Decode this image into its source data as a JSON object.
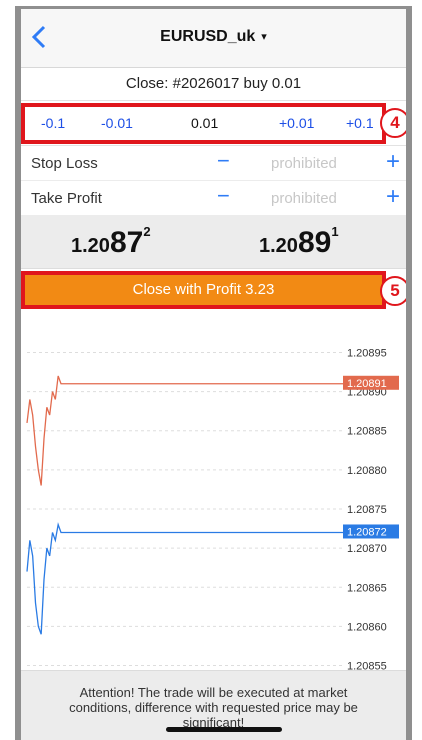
{
  "header": {
    "title": "EURUSD_uk",
    "caret": "▾",
    "back_icon": "chevron-left-icon"
  },
  "close_line": "Close: #2026017 buy 0.01",
  "volume": {
    "dec_large": "-0.1",
    "dec_small": "-0.01",
    "value": "0.01",
    "inc_small": "+0.01",
    "inc_large": "+0.1"
  },
  "callouts": {
    "first": "4",
    "second": "5"
  },
  "stop_loss": {
    "label": "Stop Loss",
    "minus": "−",
    "value": "prohibited",
    "plus": "+"
  },
  "take_profit": {
    "label": "Take Profit",
    "minus": "−",
    "value": "prohibited",
    "plus": "+"
  },
  "prices": {
    "bid": {
      "pre": "1.20",
      "big": "87",
      "sup": "2"
    },
    "ask": {
      "pre": "1.20",
      "big": "89",
      "sup": "1"
    }
  },
  "close_button": "Close with Profit 3.23",
  "chart_data": {
    "type": "line",
    "y_ticks": [
      "1.20895",
      "1.20890",
      "1.20885",
      "1.20880",
      "1.20875",
      "1.20870",
      "1.20865",
      "1.20860",
      "1.20855"
    ],
    "ylim": [
      1.20852,
      1.20898
    ],
    "series": [
      {
        "color": "#e26a4d",
        "current_label": "1.20891",
        "current_value": 1.20891,
        "values": [
          1.20886,
          1.20889,
          1.20887,
          1.20883,
          1.2088,
          1.20878,
          1.20884,
          1.20888,
          1.20887,
          1.2089,
          1.20889,
          1.20892,
          1.20891
        ]
      },
      {
        "color": "#2a7be4",
        "current_label": "1.20872",
        "current_value": 1.20872,
        "values": [
          1.20867,
          1.20871,
          1.20869,
          1.20863,
          1.2086,
          1.20859,
          1.20866,
          1.2087,
          1.20869,
          1.20872,
          1.20871,
          1.20873,
          1.20872
        ]
      }
    ]
  },
  "footer": {
    "line1": "Attention! The trade will be executed at market",
    "line2": "conditions, difference with requested price may be",
    "line3": "significant!"
  },
  "accent_colors": {
    "highlight": "#e0161c",
    "button": "#f28a14",
    "link": "#1d4fe6"
  }
}
